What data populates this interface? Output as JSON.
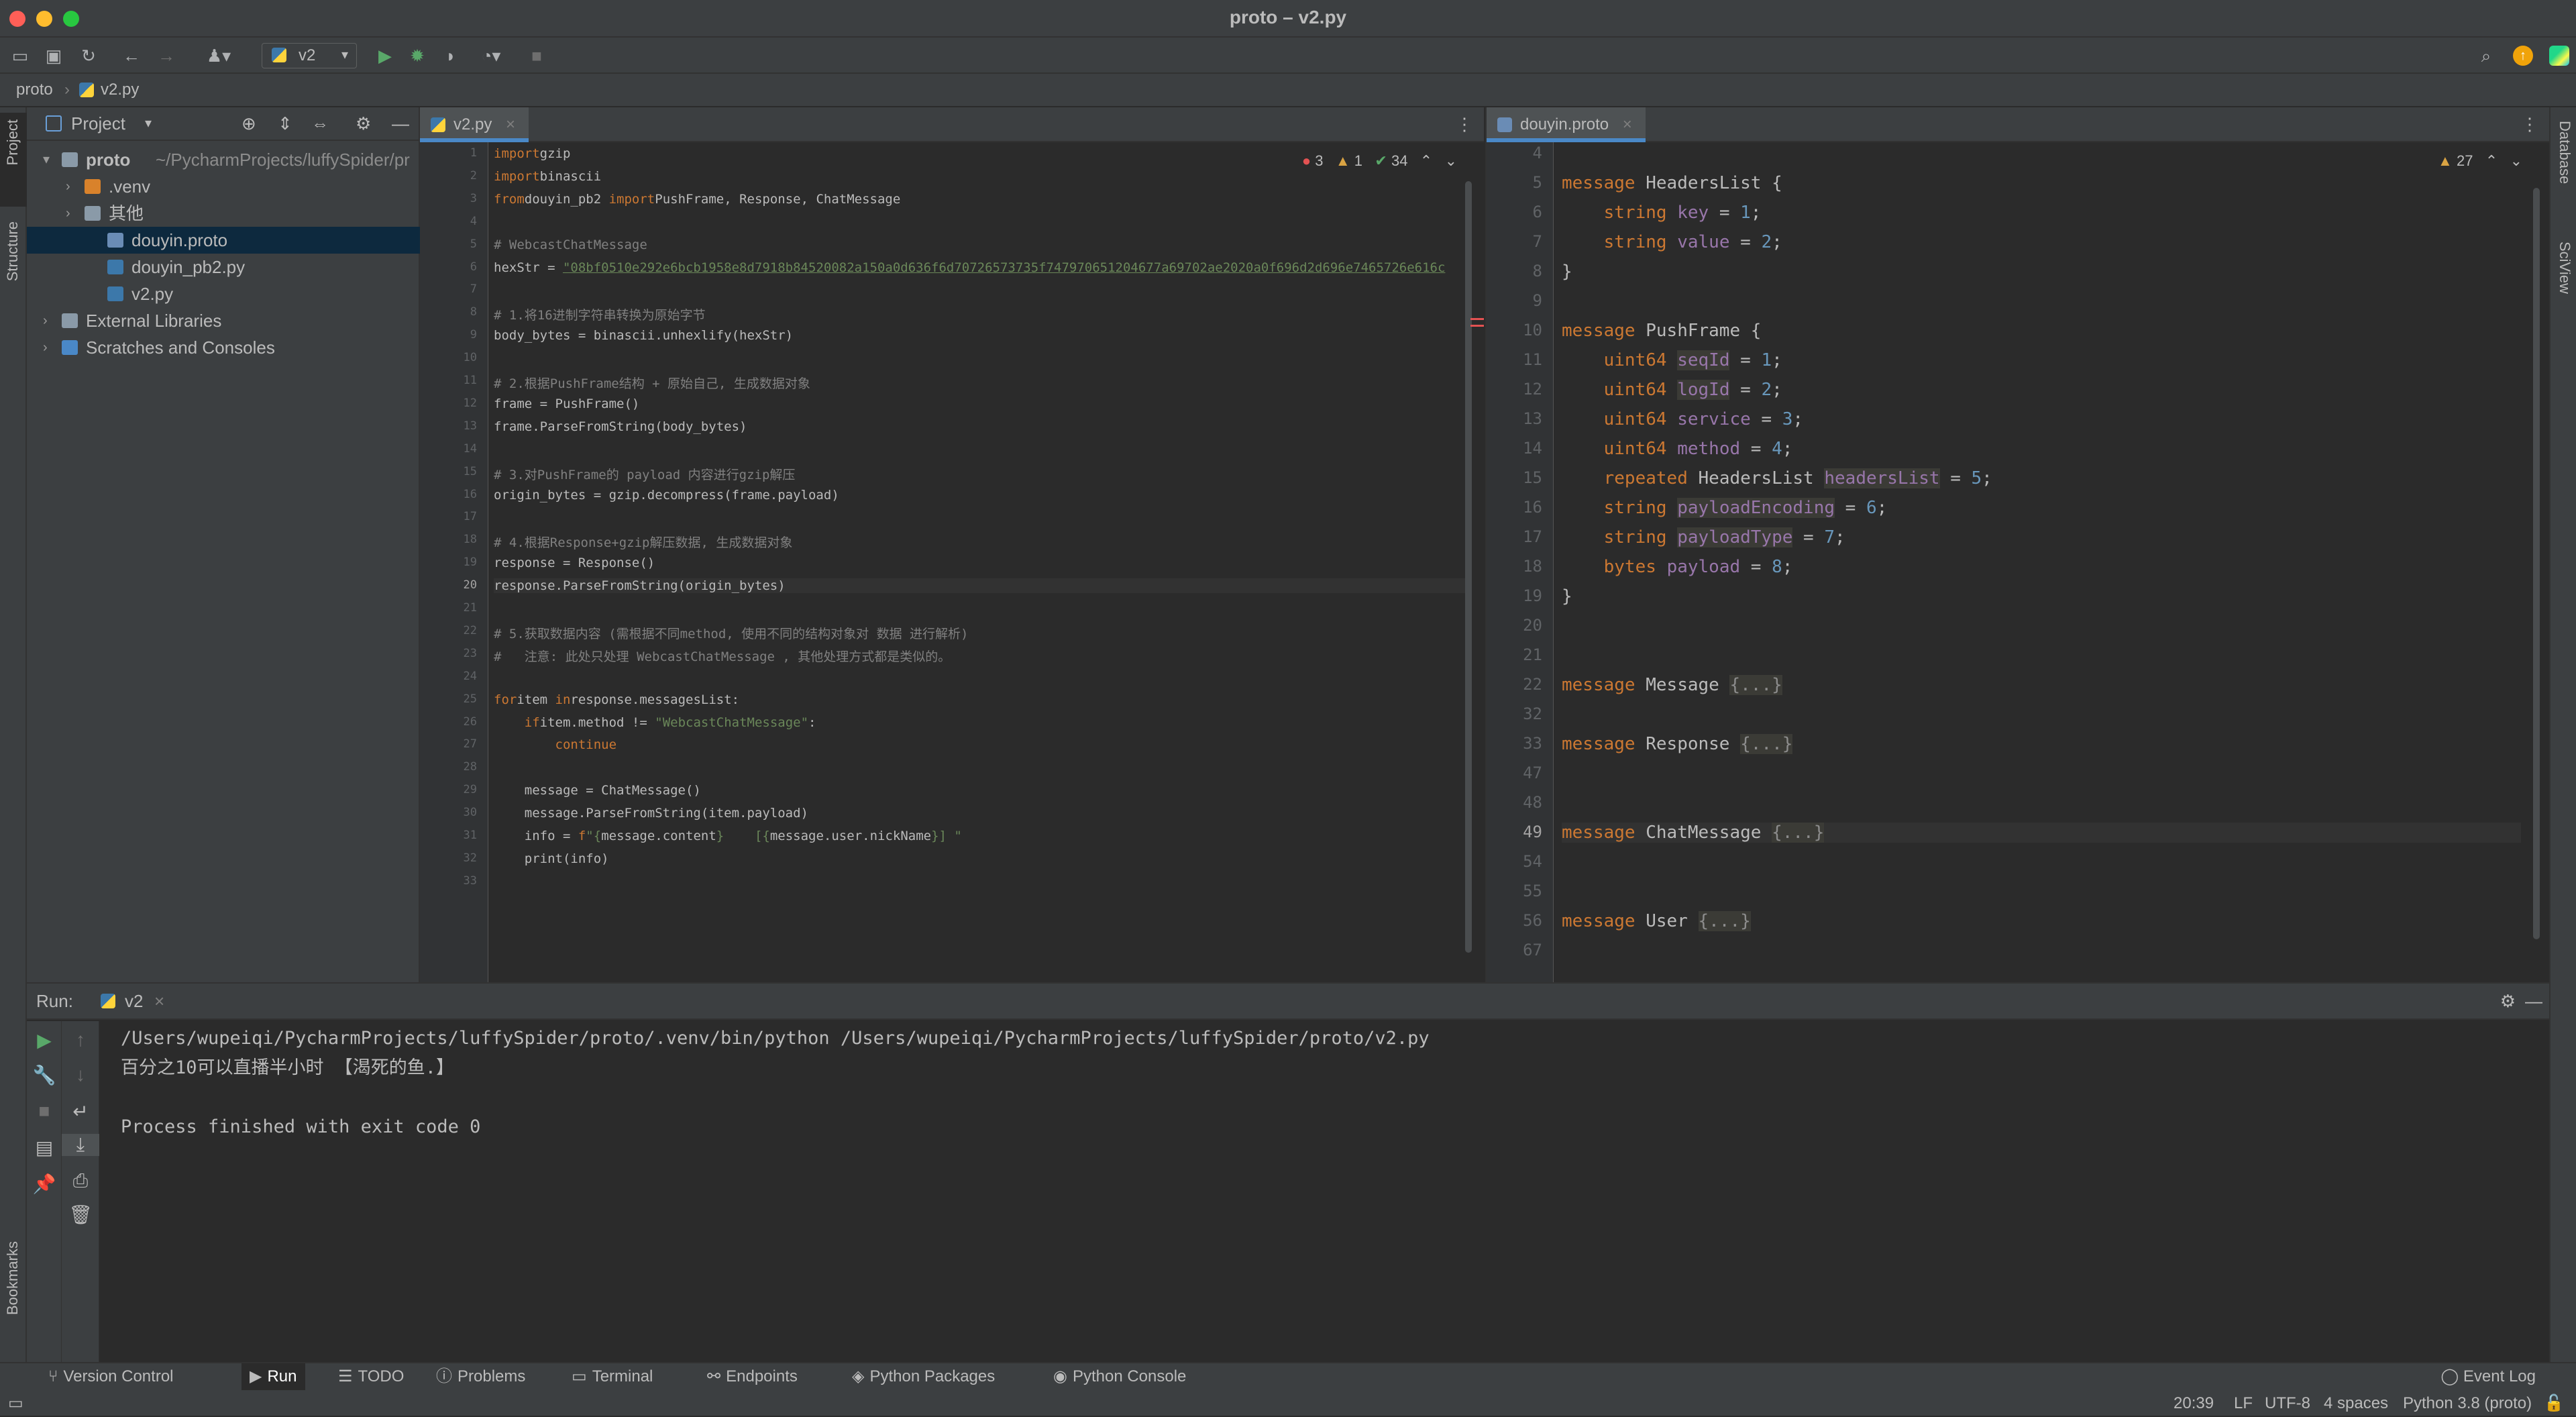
{
  "window": {
    "title": "proto – v2.py"
  },
  "toolbar": {
    "run_config": "v2"
  },
  "navbar": {
    "crumb1": "proto",
    "crumb2": "v2.py"
  },
  "sidestrip": {
    "project": "Project",
    "structure": "Structure",
    "bookmarks": "Bookmarks",
    "database": "Database",
    "sciview": "SciView"
  },
  "project": {
    "title": "Project",
    "tree": [
      {
        "label": "proto",
        "extra": "~/PycharmProjects/luffySpider/pr",
        "indent": 0,
        "type": "folder",
        "selected": false,
        "bold": true
      },
      {
        "label": ".venv",
        "extra": "",
        "indent": 1,
        "type": "folder-orange",
        "selected": false,
        "bold": false
      },
      {
        "label": "其他",
        "extra": "",
        "indent": 1,
        "type": "folder",
        "selected": false,
        "bold": false
      },
      {
        "label": "douyin.proto",
        "extra": "",
        "indent": 2,
        "type": "file",
        "selected": true,
        "bold": false
      },
      {
        "label": "douyin_pb2.py",
        "extra": "",
        "indent": 2,
        "type": "py",
        "selected": false,
        "bold": false
      },
      {
        "label": "v2.py",
        "extra": "",
        "indent": 2,
        "type": "py",
        "selected": false,
        "bold": false
      },
      {
        "label": "External Libraries",
        "extra": "",
        "indent": 0,
        "type": "lib",
        "selected": false,
        "bold": false
      },
      {
        "label": "Scratches and Consoles",
        "extra": "",
        "indent": 0,
        "type": "scratch",
        "selected": false,
        "bold": false
      }
    ]
  },
  "editor1": {
    "tab": "v2.py",
    "errors": "3",
    "warnings": "1",
    "weak": "34",
    "lines": [
      [
        [
          "kw",
          "import"
        ],
        [
          "",
          "gzip"
        ]
      ],
      [
        [
          "kw",
          "import"
        ],
        [
          "",
          "binascii"
        ]
      ],
      [
        [
          "kw",
          "from"
        ],
        [
          "",
          "douyin_pb2 "
        ],
        [
          "kw",
          "import"
        ],
        [
          "",
          "PushFrame, Response, ChatMessage"
        ]
      ],
      [],
      [
        [
          "cmt",
          "# WebcastChatMessage"
        ]
      ],
      [
        [
          "",
          "hexStr = "
        ],
        [
          "str",
          "\"08bf0510e292e6bcb1958e8d7918b84520082a150a0d636f6d70726573735f747970651204677a69702ae2020a0f696d2d696e7465726e616c"
        ]
      ],
      [],
      [
        [
          "cmt",
          "# 1.将16进制字符串转换为原始字节"
        ]
      ],
      [
        [
          "",
          "body_bytes = binascii.unhexlify(hexStr)"
        ]
      ],
      [],
      [
        [
          "cmt",
          "# 2.根据PushFrame结构 + 原始自己, 生成数据对象"
        ]
      ],
      [
        [
          "",
          "frame = PushFrame()"
        ]
      ],
      [
        [
          "",
          "frame.ParseFromString(body_bytes)"
        ]
      ],
      [],
      [
        [
          "cmt",
          "# 3.对PushFrame的 payload 内容进行gzip解压"
        ]
      ],
      [
        [
          "",
          "origin_bytes = gzip.decompress(frame.payload)"
        ]
      ],
      [],
      [
        [
          "cmt",
          "# 4.根据Response+gzip解压数据, 生成数据对象"
        ]
      ],
      [
        [
          "",
          "response = Response()"
        ]
      ],
      [
        [
          "",
          "response.ParseFromString(origin_bytes)"
        ]
      ],
      [],
      [
        [
          "cmt",
          "# 5.获取数据内容 (需根据不同method, 使用不同的结构对象对 数据 进行解析)"
        ]
      ],
      [
        [
          "cmt",
          "#   注意: 此处只处理 WebcastChatMessage , 其他处理方式都是类似的。"
        ]
      ],
      [],
      [
        [
          "kw",
          "for"
        ],
        [
          "",
          "item "
        ],
        [
          "kw",
          "in"
        ],
        [
          "",
          "response.messagesList:"
        ]
      ],
      [
        [
          "",
          "    "
        ],
        [
          "kw",
          "if"
        ],
        [
          "",
          "item.method != "
        ],
        [
          "str",
          "\"WebcastChatMessage\""
        ],
        [
          "",
          ":"
        ]
      ],
      [
        [
          "",
          "        "
        ],
        [
          "kw",
          "continue"
        ]
      ],
      [],
      [
        [
          "",
          "    message = ChatMessage()"
        ]
      ],
      [
        [
          "",
          "    message.ParseFromString(item.payload)"
        ]
      ],
      [
        [
          "",
          "    info = "
        ],
        [
          "kw",
          "f"
        ],
        [
          "str",
          "\"{"
        ],
        [
          "",
          "message.content"
        ],
        [
          "str",
          "}    [{"
        ],
        [
          "",
          "message.user.nickName"
        ],
        [
          "str",
          "}] \""
        ]
      ],
      [
        [
          "",
          "    print(info)"
        ]
      ],
      []
    ]
  },
  "editor2": {
    "tab": "douyin.proto",
    "warnings": "27",
    "lines": [
      {
        "n": "4",
        "t": []
      },
      {
        "n": "5",
        "t": [
          [
            "kw",
            "message"
          ],
          [
            "",
            " HeadersList {"
          ]
        ]
      },
      {
        "n": "6",
        "t": [
          [
            "",
            "    "
          ],
          [
            "kw",
            "string"
          ],
          [
            "",
            " "
          ],
          [
            "purp",
            "key"
          ],
          [
            "",
            " = "
          ],
          [
            "num",
            "1"
          ],
          [
            "",
            ";"
          ]
        ]
      },
      {
        "n": "7",
        "t": [
          [
            "",
            "    "
          ],
          [
            "kw",
            "string"
          ],
          [
            "",
            " "
          ],
          [
            "purp",
            "value"
          ],
          [
            "",
            " = "
          ],
          [
            "num",
            "2"
          ],
          [
            "",
            ";"
          ]
        ]
      },
      {
        "n": "8",
        "t": [
          [
            "",
            "}"
          ]
        ]
      },
      {
        "n": "9",
        "t": []
      },
      {
        "n": "10",
        "t": [
          [
            "kw",
            "message"
          ],
          [
            "",
            " PushFrame {"
          ]
        ]
      },
      {
        "n": "11",
        "t": [
          [
            "",
            "    "
          ],
          [
            "kw",
            "uint64"
          ],
          [
            "",
            " "
          ],
          [
            "purp",
            "seqId"
          ],
          [
            "",
            " = "
          ],
          [
            "num",
            "1"
          ],
          [
            "",
            ";"
          ]
        ]
      },
      {
        "n": "12",
        "t": [
          [
            "",
            "    "
          ],
          [
            "kw",
            "uint64"
          ],
          [
            "",
            " "
          ],
          [
            "purp",
            "logId"
          ],
          [
            "",
            " = "
          ],
          [
            "num",
            "2"
          ],
          [
            "",
            ";"
          ]
        ]
      },
      {
        "n": "13",
        "t": [
          [
            "",
            "    "
          ],
          [
            "kw",
            "uint64"
          ],
          [
            "",
            " "
          ],
          [
            "purp",
            "service"
          ],
          [
            "",
            " = "
          ],
          [
            "num",
            "3"
          ],
          [
            "",
            ";"
          ]
        ]
      },
      {
        "n": "14",
        "t": [
          [
            "",
            "    "
          ],
          [
            "kw",
            "uint64"
          ],
          [
            "",
            " "
          ],
          [
            "purp",
            "method"
          ],
          [
            "",
            " = "
          ],
          [
            "num",
            "4"
          ],
          [
            "",
            ";"
          ]
        ]
      },
      {
        "n": "15",
        "t": [
          [
            "",
            "    "
          ],
          [
            "kw",
            "repeated"
          ],
          [
            "",
            " HeadersList "
          ],
          [
            "purp",
            "headersList"
          ],
          [
            "",
            " = "
          ],
          [
            "num",
            "5"
          ],
          [
            "",
            ";"
          ]
        ]
      },
      {
        "n": "16",
        "t": [
          [
            "",
            "    "
          ],
          [
            "kw",
            "string"
          ],
          [
            "",
            " "
          ],
          [
            "purp",
            "payloadEncoding"
          ],
          [
            "",
            " = "
          ],
          [
            "num",
            "6"
          ],
          [
            "",
            ";"
          ]
        ]
      },
      {
        "n": "17",
        "t": [
          [
            "",
            "    "
          ],
          [
            "kw",
            "string"
          ],
          [
            "",
            " "
          ],
          [
            "purp",
            "payloadType"
          ],
          [
            "",
            " = "
          ],
          [
            "num",
            "7"
          ],
          [
            "",
            ";"
          ]
        ]
      },
      {
        "n": "18",
        "t": [
          [
            "",
            "    "
          ],
          [
            "kw",
            "bytes"
          ],
          [
            "",
            " "
          ],
          [
            "purp",
            "payload"
          ],
          [
            "",
            " = "
          ],
          [
            "num",
            "8"
          ],
          [
            "",
            ";"
          ]
        ]
      },
      {
        "n": "19",
        "t": [
          [
            "",
            "}"
          ]
        ]
      },
      {
        "n": "20",
        "t": []
      },
      {
        "n": "21",
        "t": []
      },
      {
        "n": "22",
        "t": [
          [
            "kw",
            "message"
          ],
          [
            "",
            " Message "
          ],
          [
            "cmt",
            "{...}"
          ]
        ]
      },
      {
        "n": "32",
        "t": []
      },
      {
        "n": "33",
        "t": [
          [
            "kw",
            "message"
          ],
          [
            "",
            " Response "
          ],
          [
            "cmt",
            "{...}"
          ]
        ]
      },
      {
        "n": "47",
        "t": []
      },
      {
        "n": "48",
        "t": []
      },
      {
        "n": "49",
        "t": [
          [
            "kw",
            "message"
          ],
          [
            "",
            " ChatMessage "
          ],
          [
            "cmt",
            "{...}"
          ]
        ]
      },
      {
        "n": "54",
        "t": []
      },
      {
        "n": "55",
        "t": []
      },
      {
        "n": "56",
        "t": [
          [
            "kw",
            "message"
          ],
          [
            "",
            " User "
          ],
          [
            "cmt",
            "{...}"
          ]
        ]
      },
      {
        "n": "67",
        "t": []
      }
    ]
  },
  "run": {
    "label": "Run:",
    "config": "v2",
    "output": [
      "/Users/wupeiqi/PycharmProjects/luffySpider/proto/.venv/bin/python /Users/wupeiqi/PycharmProjects/luffySpider/proto/v2.py",
      "百分之10可以直播半小时    【渴死的鱼.】",
      "",
      "Process finished with exit code 0"
    ]
  },
  "bottom_tabs": [
    "Version Control",
    "Run",
    "TODO",
    "Problems",
    "Terminal",
    "Endpoints",
    "Python Packages",
    "Python Console"
  ],
  "event_log": "Event Log",
  "status": {
    "pos": "20:39",
    "lf": "LF",
    "enc": "UTF-8",
    "indent": "4 spaces",
    "interp": "Python 3.8 (proto)"
  }
}
